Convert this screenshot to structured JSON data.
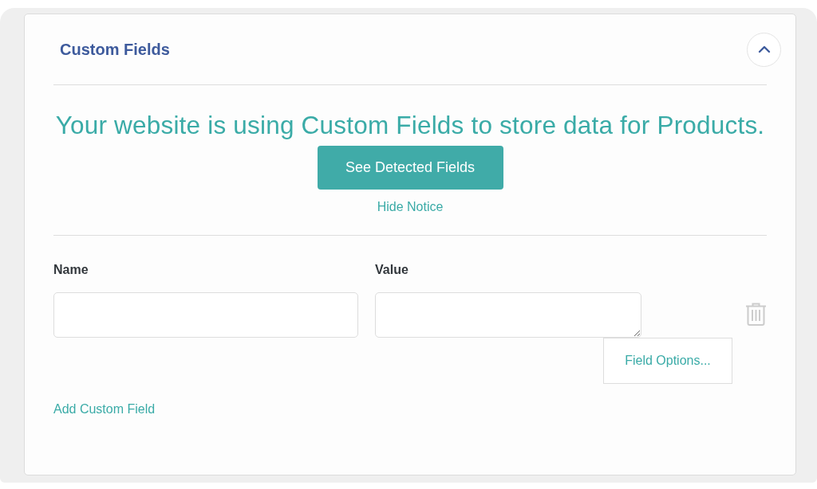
{
  "panel": {
    "title": "Custom Fields",
    "expanded": true
  },
  "notice": {
    "message": "Your website is using Custom Fields to store data for Products.",
    "button": "See Detected Fields",
    "dismiss": "Hide Notice"
  },
  "columns": [
    {
      "label": "Name",
      "kind": "input"
    },
    {
      "label": "Value",
      "kind": "textarea"
    }
  ],
  "rows": [
    {
      "field_options": "Field Options..."
    }
  ],
  "add_link": "Add Custom Field"
}
